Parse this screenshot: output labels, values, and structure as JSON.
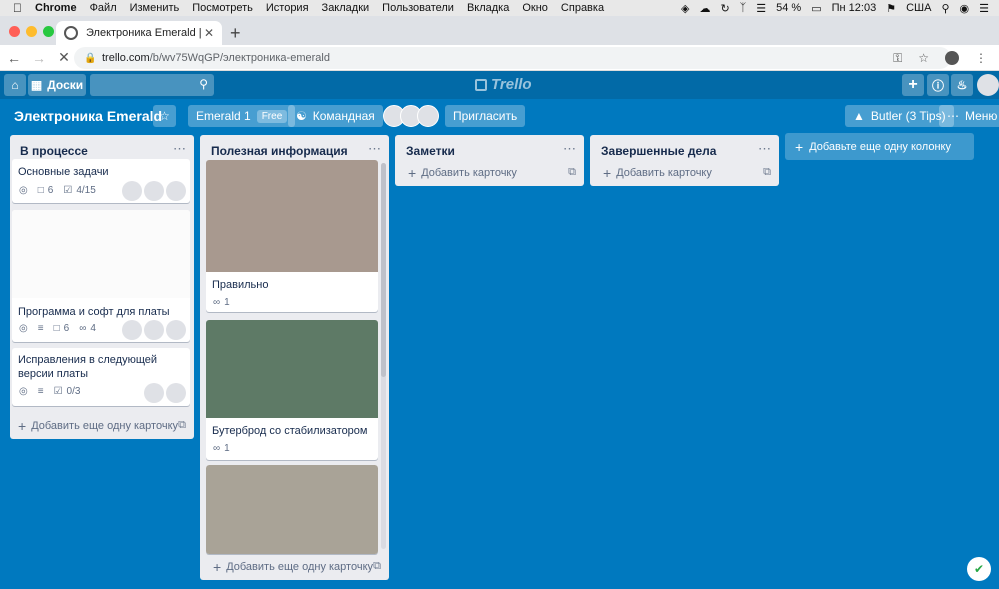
{
  "menubar": {
    "app": "Chrome",
    "items": [
      "Файл",
      "Изменить",
      "Посмотреть",
      "История",
      "Закладки",
      "Пользователи",
      "Вкладка",
      "Окно",
      "Справка"
    ],
    "battery": "54 %",
    "clock": "Пн 12:03",
    "locale": "США"
  },
  "browser": {
    "tab_title": "Электроника Emerald | Trello",
    "url_host": "trello.com",
    "url_path": "/b/wv75WqGP/электроника-emerald"
  },
  "header": {
    "boards_label": "Доски",
    "logo_text": "Trello"
  },
  "board": {
    "title": "Электроника Emerald",
    "team_label": "Emerald 1",
    "team_badge": "Free",
    "visibility_label": "Командная",
    "invite_label": "Пригласить",
    "butler_label": "Butler (3 Tips)",
    "menu_label": "Меню",
    "add_list_label": "Добавьте еще одну колонку"
  },
  "lists": [
    {
      "title": "В процессе",
      "add_label": "Добавить еще одну карточку",
      "cards": [
        {
          "title": "Основные задачи",
          "comments": "6",
          "checklist": "4/15"
        },
        {
          "title": "Программа и софт для платы",
          "comments": "6",
          "attachments": "4"
        },
        {
          "title": "Исправления в следующей версии платы",
          "checklist": "0/3"
        }
      ]
    },
    {
      "title": "Полезная информация",
      "add_label": "Добавить еще одну карточку",
      "cards": [
        {
          "title": "Правильно",
          "attachments": "1",
          "cover_color": "#a8998f"
        },
        {
          "title": "Бутерброд со стабилизатором",
          "attachments": "1",
          "cover_color": "#5e7a66"
        },
        {
          "title": "",
          "cover_color": "#a9a397"
        }
      ]
    },
    {
      "title": "Заметки",
      "add_label": "Добавить карточку"
    },
    {
      "title": "Завершенные дела",
      "add_label": "Добавить карточку"
    }
  ],
  "colors": {
    "board_bg": "#0079bf",
    "header_bg": "#026aa7",
    "list_bg": "#ebecf0"
  }
}
